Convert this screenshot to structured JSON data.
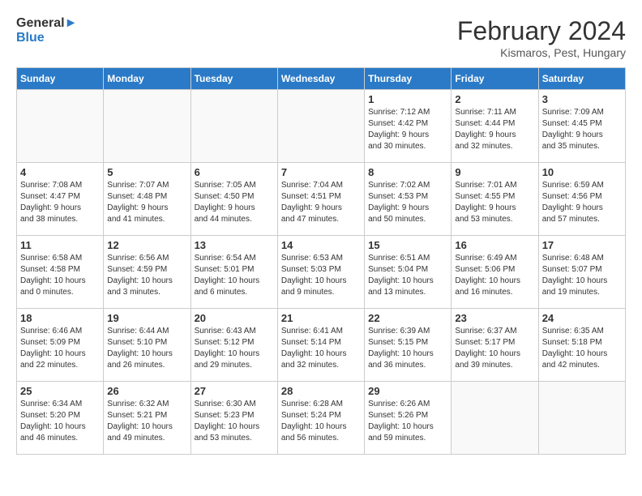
{
  "header": {
    "logo_line1": "General",
    "logo_line2": "Blue",
    "month": "February 2024",
    "location": "Kismaros, Pest, Hungary"
  },
  "days_of_week": [
    "Sunday",
    "Monday",
    "Tuesday",
    "Wednesday",
    "Thursday",
    "Friday",
    "Saturday"
  ],
  "weeks": [
    [
      {
        "day": "",
        "info": ""
      },
      {
        "day": "",
        "info": ""
      },
      {
        "day": "",
        "info": ""
      },
      {
        "day": "",
        "info": ""
      },
      {
        "day": "1",
        "info": "Sunrise: 7:12 AM\nSunset: 4:42 PM\nDaylight: 9 hours\nand 30 minutes."
      },
      {
        "day": "2",
        "info": "Sunrise: 7:11 AM\nSunset: 4:44 PM\nDaylight: 9 hours\nand 32 minutes."
      },
      {
        "day": "3",
        "info": "Sunrise: 7:09 AM\nSunset: 4:45 PM\nDaylight: 9 hours\nand 35 minutes."
      }
    ],
    [
      {
        "day": "4",
        "info": "Sunrise: 7:08 AM\nSunset: 4:47 PM\nDaylight: 9 hours\nand 38 minutes."
      },
      {
        "day": "5",
        "info": "Sunrise: 7:07 AM\nSunset: 4:48 PM\nDaylight: 9 hours\nand 41 minutes."
      },
      {
        "day": "6",
        "info": "Sunrise: 7:05 AM\nSunset: 4:50 PM\nDaylight: 9 hours\nand 44 minutes."
      },
      {
        "day": "7",
        "info": "Sunrise: 7:04 AM\nSunset: 4:51 PM\nDaylight: 9 hours\nand 47 minutes."
      },
      {
        "day": "8",
        "info": "Sunrise: 7:02 AM\nSunset: 4:53 PM\nDaylight: 9 hours\nand 50 minutes."
      },
      {
        "day": "9",
        "info": "Sunrise: 7:01 AM\nSunset: 4:55 PM\nDaylight: 9 hours\nand 53 minutes."
      },
      {
        "day": "10",
        "info": "Sunrise: 6:59 AM\nSunset: 4:56 PM\nDaylight: 9 hours\nand 57 minutes."
      }
    ],
    [
      {
        "day": "11",
        "info": "Sunrise: 6:58 AM\nSunset: 4:58 PM\nDaylight: 10 hours\nand 0 minutes."
      },
      {
        "day": "12",
        "info": "Sunrise: 6:56 AM\nSunset: 4:59 PM\nDaylight: 10 hours\nand 3 minutes."
      },
      {
        "day": "13",
        "info": "Sunrise: 6:54 AM\nSunset: 5:01 PM\nDaylight: 10 hours\nand 6 minutes."
      },
      {
        "day": "14",
        "info": "Sunrise: 6:53 AM\nSunset: 5:03 PM\nDaylight: 10 hours\nand 9 minutes."
      },
      {
        "day": "15",
        "info": "Sunrise: 6:51 AM\nSunset: 5:04 PM\nDaylight: 10 hours\nand 13 minutes."
      },
      {
        "day": "16",
        "info": "Sunrise: 6:49 AM\nSunset: 5:06 PM\nDaylight: 10 hours\nand 16 minutes."
      },
      {
        "day": "17",
        "info": "Sunrise: 6:48 AM\nSunset: 5:07 PM\nDaylight: 10 hours\nand 19 minutes."
      }
    ],
    [
      {
        "day": "18",
        "info": "Sunrise: 6:46 AM\nSunset: 5:09 PM\nDaylight: 10 hours\nand 22 minutes."
      },
      {
        "day": "19",
        "info": "Sunrise: 6:44 AM\nSunset: 5:10 PM\nDaylight: 10 hours\nand 26 minutes."
      },
      {
        "day": "20",
        "info": "Sunrise: 6:43 AM\nSunset: 5:12 PM\nDaylight: 10 hours\nand 29 minutes."
      },
      {
        "day": "21",
        "info": "Sunrise: 6:41 AM\nSunset: 5:14 PM\nDaylight: 10 hours\nand 32 minutes."
      },
      {
        "day": "22",
        "info": "Sunrise: 6:39 AM\nSunset: 5:15 PM\nDaylight: 10 hours\nand 36 minutes."
      },
      {
        "day": "23",
        "info": "Sunrise: 6:37 AM\nSunset: 5:17 PM\nDaylight: 10 hours\nand 39 minutes."
      },
      {
        "day": "24",
        "info": "Sunrise: 6:35 AM\nSunset: 5:18 PM\nDaylight: 10 hours\nand 42 minutes."
      }
    ],
    [
      {
        "day": "25",
        "info": "Sunrise: 6:34 AM\nSunset: 5:20 PM\nDaylight: 10 hours\nand 46 minutes."
      },
      {
        "day": "26",
        "info": "Sunrise: 6:32 AM\nSunset: 5:21 PM\nDaylight: 10 hours\nand 49 minutes."
      },
      {
        "day": "27",
        "info": "Sunrise: 6:30 AM\nSunset: 5:23 PM\nDaylight: 10 hours\nand 53 minutes."
      },
      {
        "day": "28",
        "info": "Sunrise: 6:28 AM\nSunset: 5:24 PM\nDaylight: 10 hours\nand 56 minutes."
      },
      {
        "day": "29",
        "info": "Sunrise: 6:26 AM\nSunset: 5:26 PM\nDaylight: 10 hours\nand 59 minutes."
      },
      {
        "day": "",
        "info": ""
      },
      {
        "day": "",
        "info": ""
      }
    ]
  ]
}
